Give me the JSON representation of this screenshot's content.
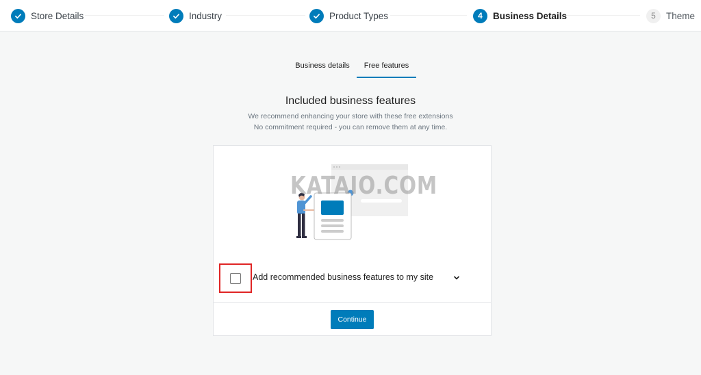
{
  "stepper": {
    "steps": [
      {
        "label": "Store Details",
        "status": "done",
        "number": "1"
      },
      {
        "label": "Industry",
        "status": "done",
        "number": "2"
      },
      {
        "label": "Product Types",
        "status": "done",
        "number": "3"
      },
      {
        "label": "Business Details",
        "status": "active",
        "number": "4"
      },
      {
        "label": "Theme",
        "status": "pending",
        "number": "5"
      }
    ]
  },
  "tabs": [
    {
      "label": "Business details",
      "active": false
    },
    {
      "label": "Free features",
      "active": true
    }
  ],
  "main": {
    "title": "Included business features",
    "subtitle_line1": "We recommend enhancing your store with these free extensions",
    "subtitle_line2": "No commitment required - you can remove them at any time."
  },
  "card": {
    "watermark": "KATAIO.COM",
    "feature_checkbox_label": "Add recommended business features to my site",
    "feature_checked": false,
    "continue_label": "Continue"
  },
  "colors": {
    "accent": "#007cba",
    "highlight": "#e02424"
  }
}
